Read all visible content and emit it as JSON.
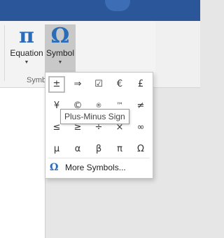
{
  "ribbon": {
    "equation": {
      "glyph": "π",
      "label": "Equation",
      "caret": "▼"
    },
    "symbol": {
      "glyph": "Ω",
      "label": "Symbol",
      "caret": "▼"
    },
    "group_label": "Symb"
  },
  "symbols": {
    "rows": [
      [
        "±",
        "⇒",
        "☑",
        "€",
        "£"
      ],
      [
        "¥",
        "©",
        "®",
        "™",
        "≠"
      ],
      [
        "≤",
        "≥",
        "÷",
        "×",
        "∞"
      ],
      [
        "µ",
        "α",
        "β",
        "π",
        "Ω"
      ]
    ],
    "selected": "±",
    "more_icon": "Ω",
    "more_label": "More Symbols..."
  },
  "tooltip": {
    "text": "Plus-Minus Sign"
  },
  "colors": {
    "accent": "#2b6cb8",
    "titlebar": "#2b579a",
    "selected_button": "#c8c8c8"
  }
}
